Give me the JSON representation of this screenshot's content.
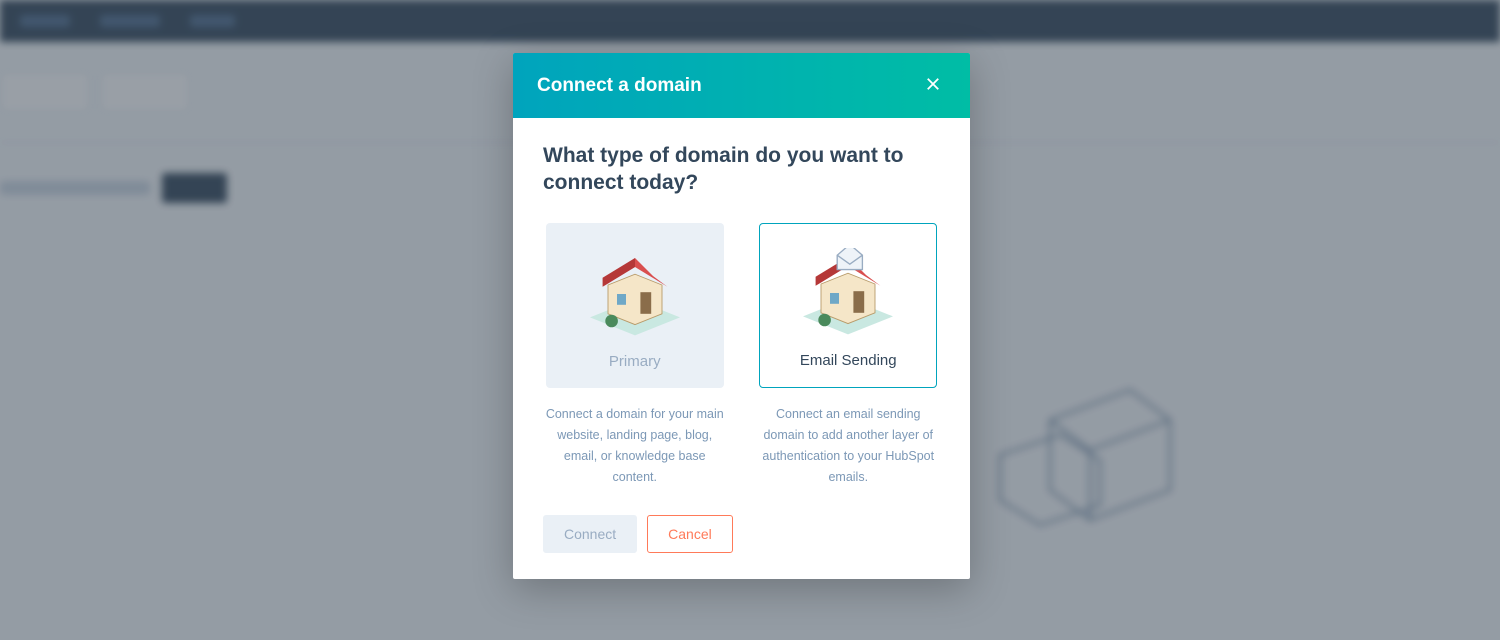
{
  "modal": {
    "title": "Connect a domain",
    "question": "What type of domain do you want to connect today?",
    "options": {
      "primary": {
        "label": "Primary",
        "desc": "Connect a domain for your main website, landing page, blog, email, or knowledge base content."
      },
      "email": {
        "label": "Email Sending",
        "desc": "Connect an email sending domain to add another layer of authentication to your HubSpot emails."
      }
    },
    "buttons": {
      "connect": "Connect",
      "cancel": "Cancel"
    }
  },
  "colors": {
    "header_grad_start": "#00a4bd",
    "header_grad_end": "#00bda5",
    "accent_orange": "#ff7a59"
  }
}
